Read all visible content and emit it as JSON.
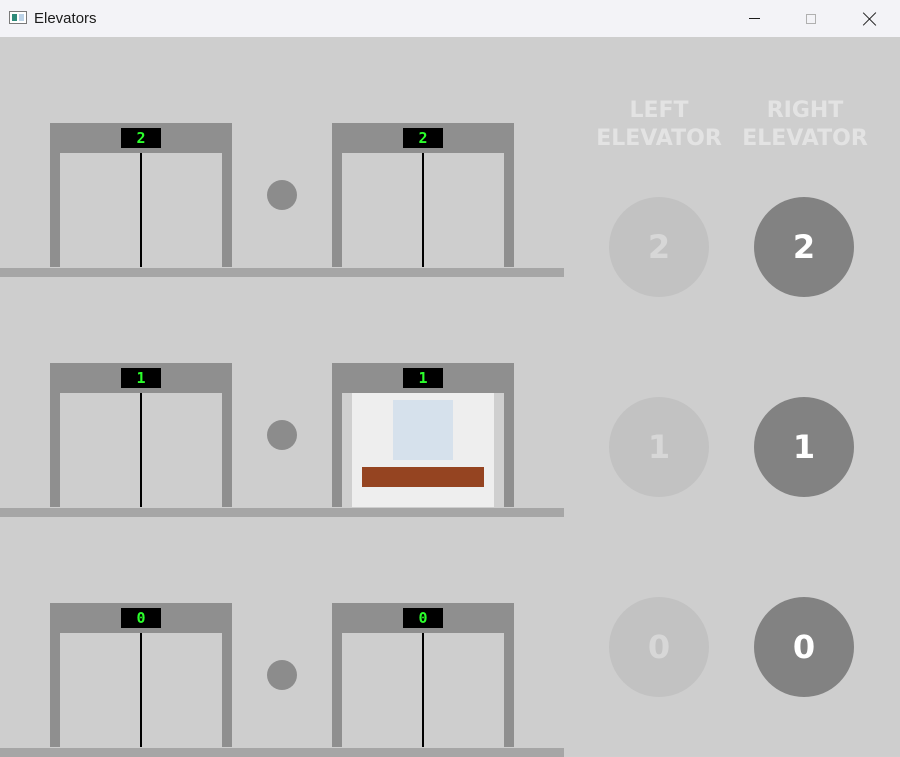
{
  "window": {
    "title": "Elevators"
  },
  "floors": [
    {
      "left_display": "2",
      "right_display": "2",
      "right_door_open": false
    },
    {
      "left_display": "1",
      "right_display": "1",
      "right_door_open": true
    },
    {
      "left_display": "0",
      "right_display": "0",
      "right_door_open": false
    }
  ],
  "panel": {
    "left_header_line1": "LEFT",
    "left_header_line2": "ELEVATOR",
    "right_header_line1": "RIGHT",
    "right_header_line2": "ELEVATOR",
    "left_buttons": [
      {
        "label": "2",
        "enabled": false
      },
      {
        "label": "1",
        "enabled": false
      },
      {
        "label": "0",
        "enabled": false
      }
    ],
    "right_buttons": [
      {
        "label": "2",
        "enabled": true
      },
      {
        "label": "1",
        "enabled": true
      },
      {
        "label": "0",
        "enabled": true
      }
    ]
  },
  "colors": {
    "background": "#cecece",
    "frame": "#8f8f8f",
    "display_text": "#2bff2b",
    "bench": "#954421",
    "active_button": "#828282",
    "disabled_button": "#c2c2c2"
  }
}
